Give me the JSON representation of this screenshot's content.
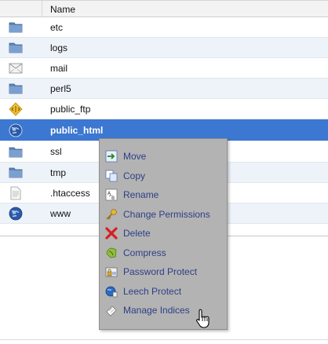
{
  "table": {
    "name_header": "Name",
    "rows": [
      {
        "name": "etc",
        "icon": "folder-icon"
      },
      {
        "name": "logs",
        "icon": "folder-icon"
      },
      {
        "name": "mail",
        "icon": "mail-envelope-icon"
      },
      {
        "name": "perl5",
        "icon": "folder-icon"
      },
      {
        "name": "public_ftp",
        "icon": "ftp-diamond-icon"
      },
      {
        "name": "public_html",
        "icon": "globe-icon",
        "selected": true
      },
      {
        "name": "ssl",
        "icon": "folder-icon"
      },
      {
        "name": "tmp",
        "icon": "folder-icon"
      },
      {
        "name": ".htaccess",
        "icon": "text-file-icon"
      },
      {
        "name": "www",
        "icon": "globe-icon"
      }
    ]
  },
  "context_menu": {
    "items": [
      {
        "label": "Move",
        "icon": "move-icon"
      },
      {
        "label": "Copy",
        "icon": "copy-icon"
      },
      {
        "label": "Rename",
        "icon": "rename-icon"
      },
      {
        "label": "Change Permissions",
        "icon": "key-icon"
      },
      {
        "label": "Delete",
        "icon": "delete-x-icon"
      },
      {
        "label": "Compress",
        "icon": "compress-icon"
      },
      {
        "label": "Password Protect",
        "icon": "password-lock-icon"
      },
      {
        "label": "Leech Protect",
        "icon": "leech-protect-icon"
      },
      {
        "label": "Manage Indices",
        "icon": "manage-indices-icon"
      }
    ]
  },
  "colors": {
    "selected_row": "#3c77d1",
    "alt_row": "#eef3fa",
    "menu_bg": "#b3b3b3",
    "menu_text": "#2e3f86"
  }
}
